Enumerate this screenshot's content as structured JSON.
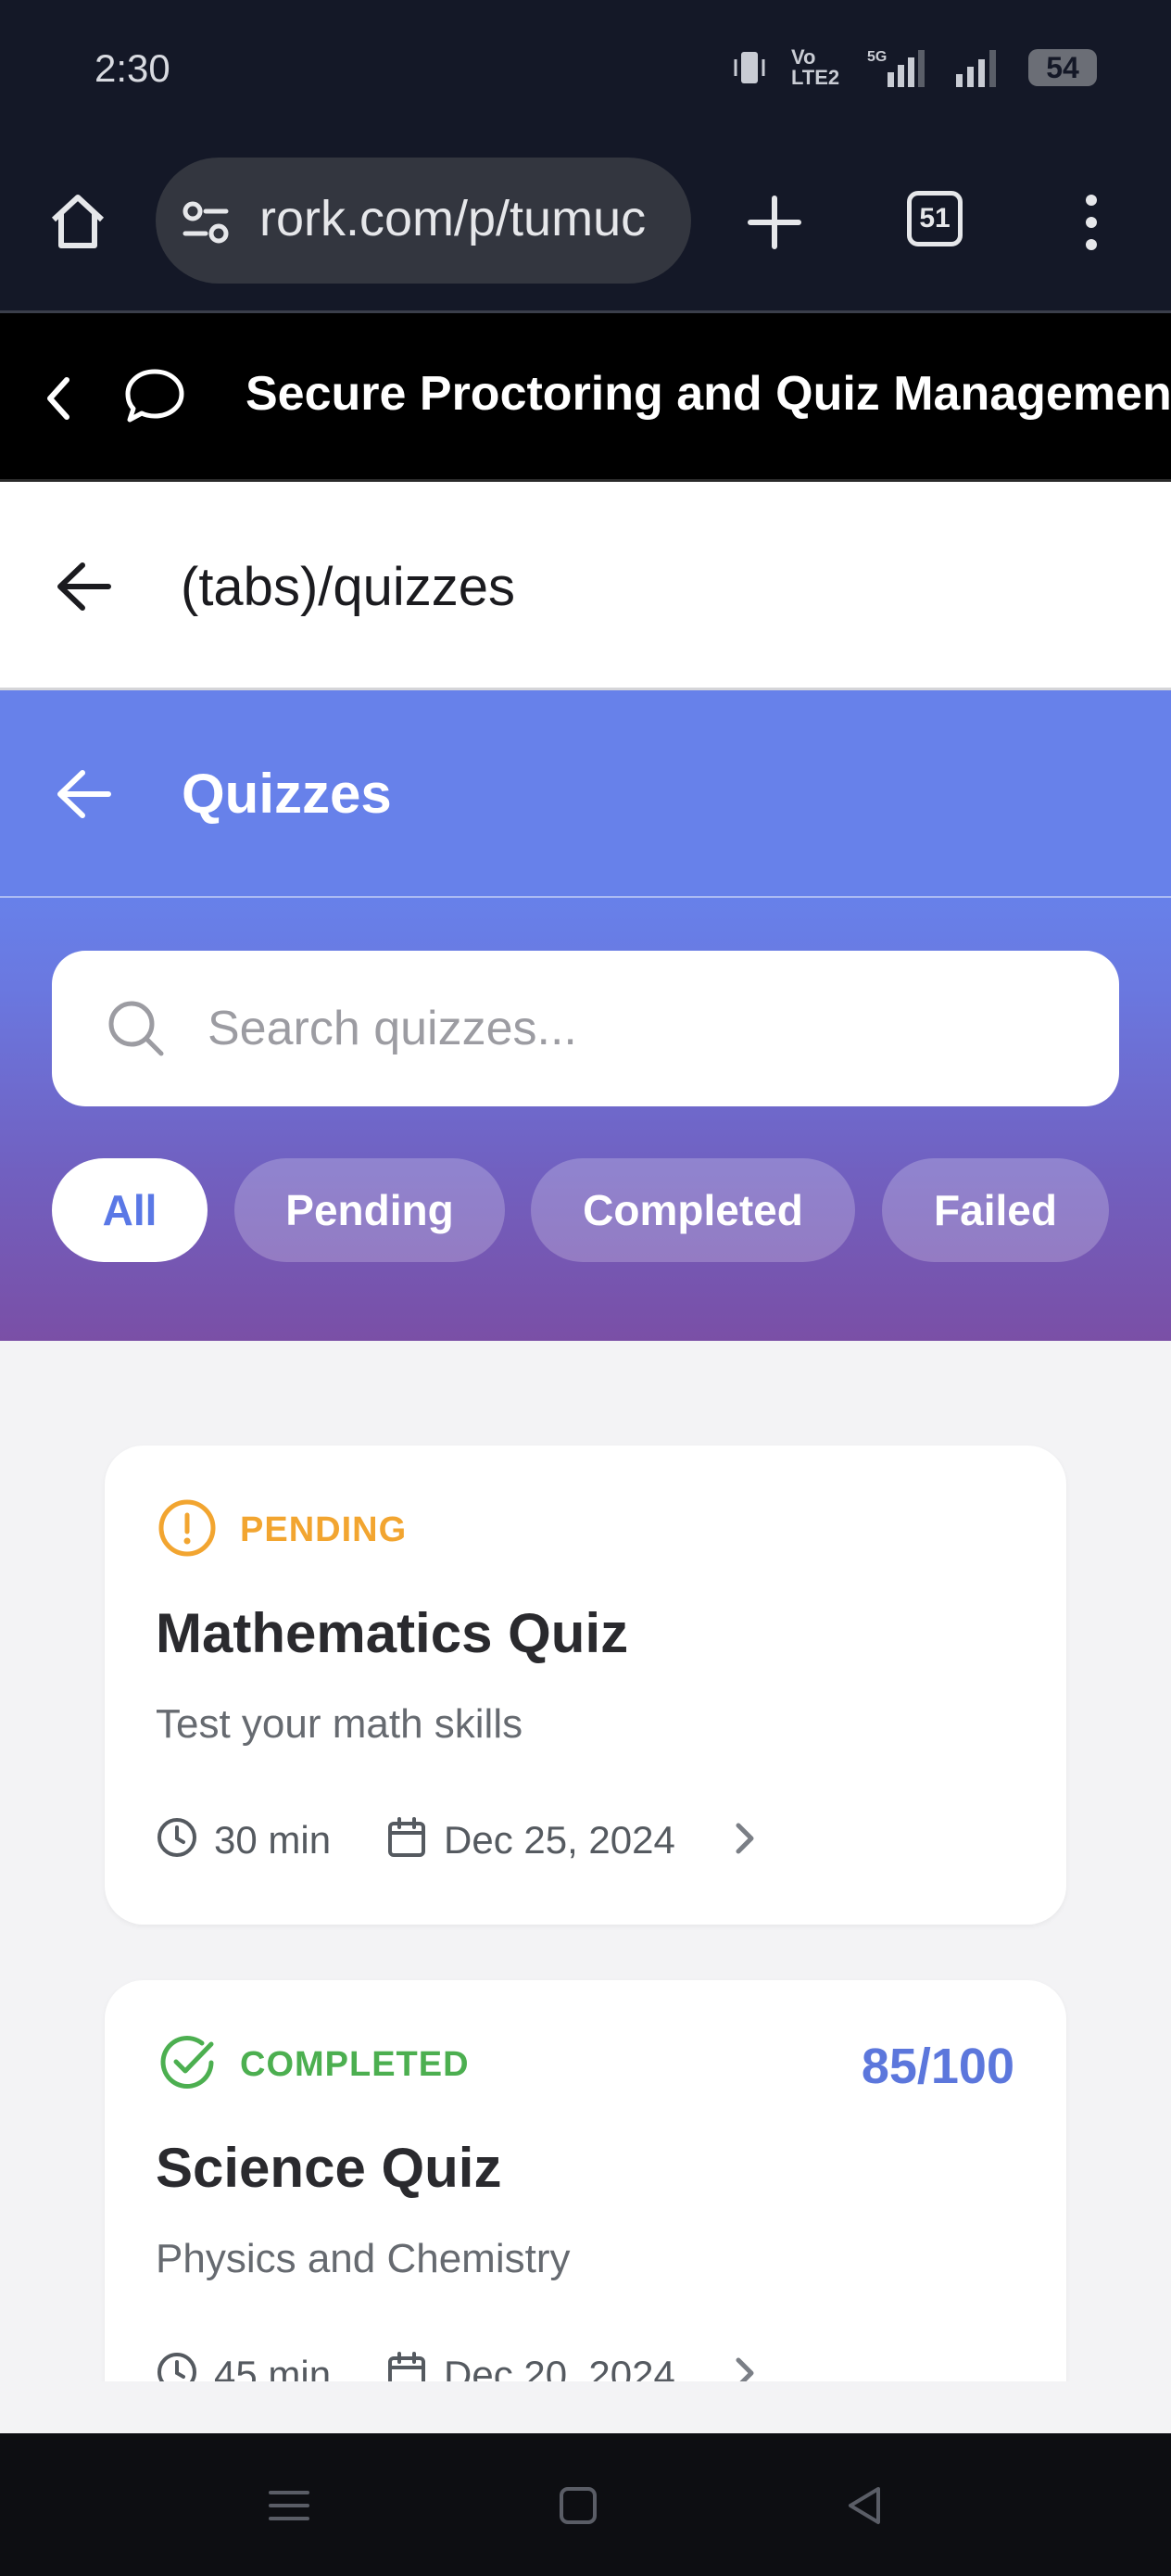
{
  "status_bar": {
    "time": "2:30",
    "network": "Vo LTE2",
    "signal": "5G",
    "battery": "54"
  },
  "browser": {
    "url": "rork.com/p/tumuc",
    "tab_count": "51"
  },
  "rork_header": {
    "title": "Secure Proctoring and Quiz Managemen"
  },
  "route_header": {
    "title": "(tabs)/quizzes"
  },
  "quizzes_header": {
    "title": "Quizzes"
  },
  "search": {
    "placeholder": "Search quizzes..."
  },
  "filters": [
    "All",
    "Pending",
    "Completed",
    "Failed"
  ],
  "active_filter": "All",
  "colors": {
    "accent": "#667eea",
    "pending": "#f2a530",
    "completed": "#4caf50",
    "score": "#5c77dc"
  },
  "quizzes": [
    {
      "status": "PENDING",
      "title": "Mathematics Quiz",
      "description": "Test your math skills",
      "duration": "30 min",
      "date": "Dec 25, 2024",
      "score": ""
    },
    {
      "status": "COMPLETED",
      "title": "Science Quiz",
      "description": "Physics and Chemistry",
      "duration": "45 min",
      "date": "Dec 20, 2024",
      "score": "85/100"
    }
  ]
}
